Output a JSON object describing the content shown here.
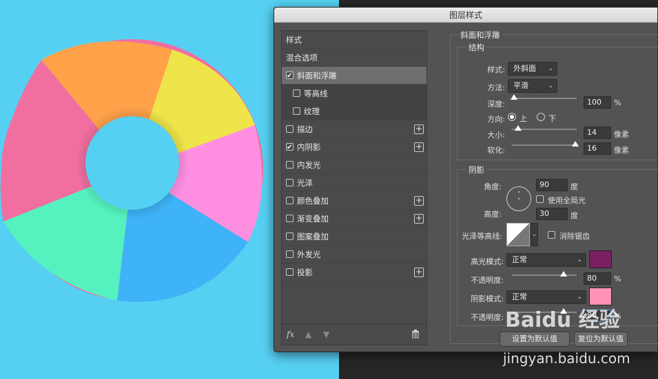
{
  "dialog": {
    "title": "图层样式"
  },
  "style_list": {
    "header": "样式",
    "blend_options": "混合选项",
    "items": [
      {
        "label": "斜面和浮雕",
        "checked": true,
        "selected": true
      },
      {
        "label": "等高线",
        "checked": false,
        "sub": true
      },
      {
        "label": "纹理",
        "checked": false,
        "sub": true
      },
      {
        "label": "描边",
        "checked": false,
        "plus": true
      },
      {
        "label": "内阴影",
        "checked": true,
        "plus": true
      },
      {
        "label": "内发光",
        "checked": false
      },
      {
        "label": "光泽",
        "checked": false
      },
      {
        "label": "颜色叠加",
        "checked": false,
        "plus": true
      },
      {
        "label": "渐变叠加",
        "checked": false,
        "plus": true
      },
      {
        "label": "图案叠加",
        "checked": false
      },
      {
        "label": "外发光",
        "checked": false
      },
      {
        "label": "投影",
        "checked": false,
        "plus": true
      }
    ],
    "footer": {
      "fx": "fx",
      "icons": [
        "fx-icon",
        "arrow-up-icon",
        "arrow-down-icon",
        "trash-icon"
      ]
    }
  },
  "bevel": {
    "section_title": "斜面和浮雕",
    "structure_title": "结构",
    "style_label": "样式:",
    "style_value": "外斜面",
    "technique_label": "方法:",
    "technique_value": "平滑",
    "depth_label": "深度:",
    "depth_value": "100",
    "depth_unit": "%",
    "direction_label": "方向:",
    "direction_up": "上",
    "direction_down": "下",
    "direction_selected": "上",
    "size_label": "大小:",
    "size_value": "14",
    "size_unit": "像素",
    "soften_label": "软化:",
    "soften_value": "16",
    "soften_unit": "像素",
    "depth_level": 0.03,
    "size_level": 0.1,
    "soften_level": 0.98
  },
  "shading": {
    "title": "阴影",
    "angle_label": "角度:",
    "angle_value": "90",
    "angle_unit": "度",
    "global_light_label": "使用全局光",
    "altitude_label": "高度:",
    "altitude_value": "30",
    "altitude_unit": "度",
    "gloss_label": "光泽等高线:",
    "antialias_label": "消除锯齿",
    "highlight_label": "高光模式:",
    "highlight_mode": "正常",
    "highlight_color": "#7b1f63",
    "highlight_opacity_label": "不透明度:",
    "highlight_opacity": "80",
    "highlight_opacity_level": 0.8,
    "shadow_label": "阴影模式:",
    "shadow_mode": "正常",
    "shadow_color": "#ff93b5",
    "shadow_opacity_label": "不透明度:",
    "shadow_opacity": "80",
    "shadow_opacity_level": 0.8,
    "percent": "%"
  },
  "buttons": {
    "make_default": "设置为默认值",
    "reset_default": "复位为默认值"
  },
  "watermark": {
    "logo": "Baidu 经验",
    "url": "jingyan.baidu.com"
  },
  "colors": {
    "canvas_bg": "#56d0f2",
    "dark_bg": "#262626",
    "dialog_bg": "#535353"
  }
}
